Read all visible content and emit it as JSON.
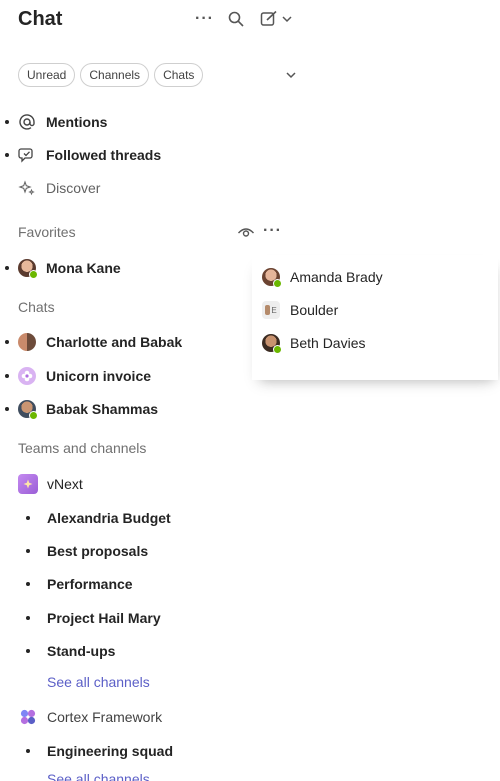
{
  "header": {
    "title": "Chat",
    "more_icon": "more-horizontal-icon",
    "search_icon": "search-icon",
    "compose_icon": "compose-icon"
  },
  "filters": [
    "Unread",
    "Channels",
    "Chats"
  ],
  "quick_links": [
    {
      "label": "Mentions",
      "icon": "mention-icon",
      "bold": true
    },
    {
      "label": "Followed threads",
      "icon": "followed-threads-icon",
      "bold": true
    },
    {
      "label": "Discover",
      "icon": "sparkle-icon",
      "bold": false
    }
  ],
  "favorites": {
    "heading": "Favorites",
    "items": [
      {
        "name": "Mona Kane",
        "status": "available"
      }
    ]
  },
  "chats": {
    "heading": "Chats",
    "items": [
      {
        "name": "Charlotte and Babak",
        "type": "group"
      },
      {
        "name": "Unicorn invoice",
        "type": "meeting"
      },
      {
        "name": "Babak Shammas",
        "type": "person",
        "status": "available"
      }
    ]
  },
  "teams": {
    "heading": "Teams and channels",
    "teams": [
      {
        "name": "vNext",
        "color": "#b46fe0",
        "channels": [
          "Alexandria Budget",
          "Best proposals",
          "Performance",
          "Project Hail Mary",
          "Stand-ups"
        ],
        "see_all": "See all channels"
      },
      {
        "name": "Cortex Framework",
        "color": "#6264a7",
        "channels": [
          "Engineering squad"
        ],
        "see_all": "See all channels"
      }
    ]
  },
  "popup": {
    "items": [
      {
        "name": "Amanda Brady",
        "status": "available"
      },
      {
        "name": "Boulder",
        "type": "room"
      },
      {
        "name": "Beth Davies",
        "status": "available"
      }
    ]
  },
  "colors": {
    "accent": "#5b5fc7",
    "presence_available": "#6bb700"
  }
}
